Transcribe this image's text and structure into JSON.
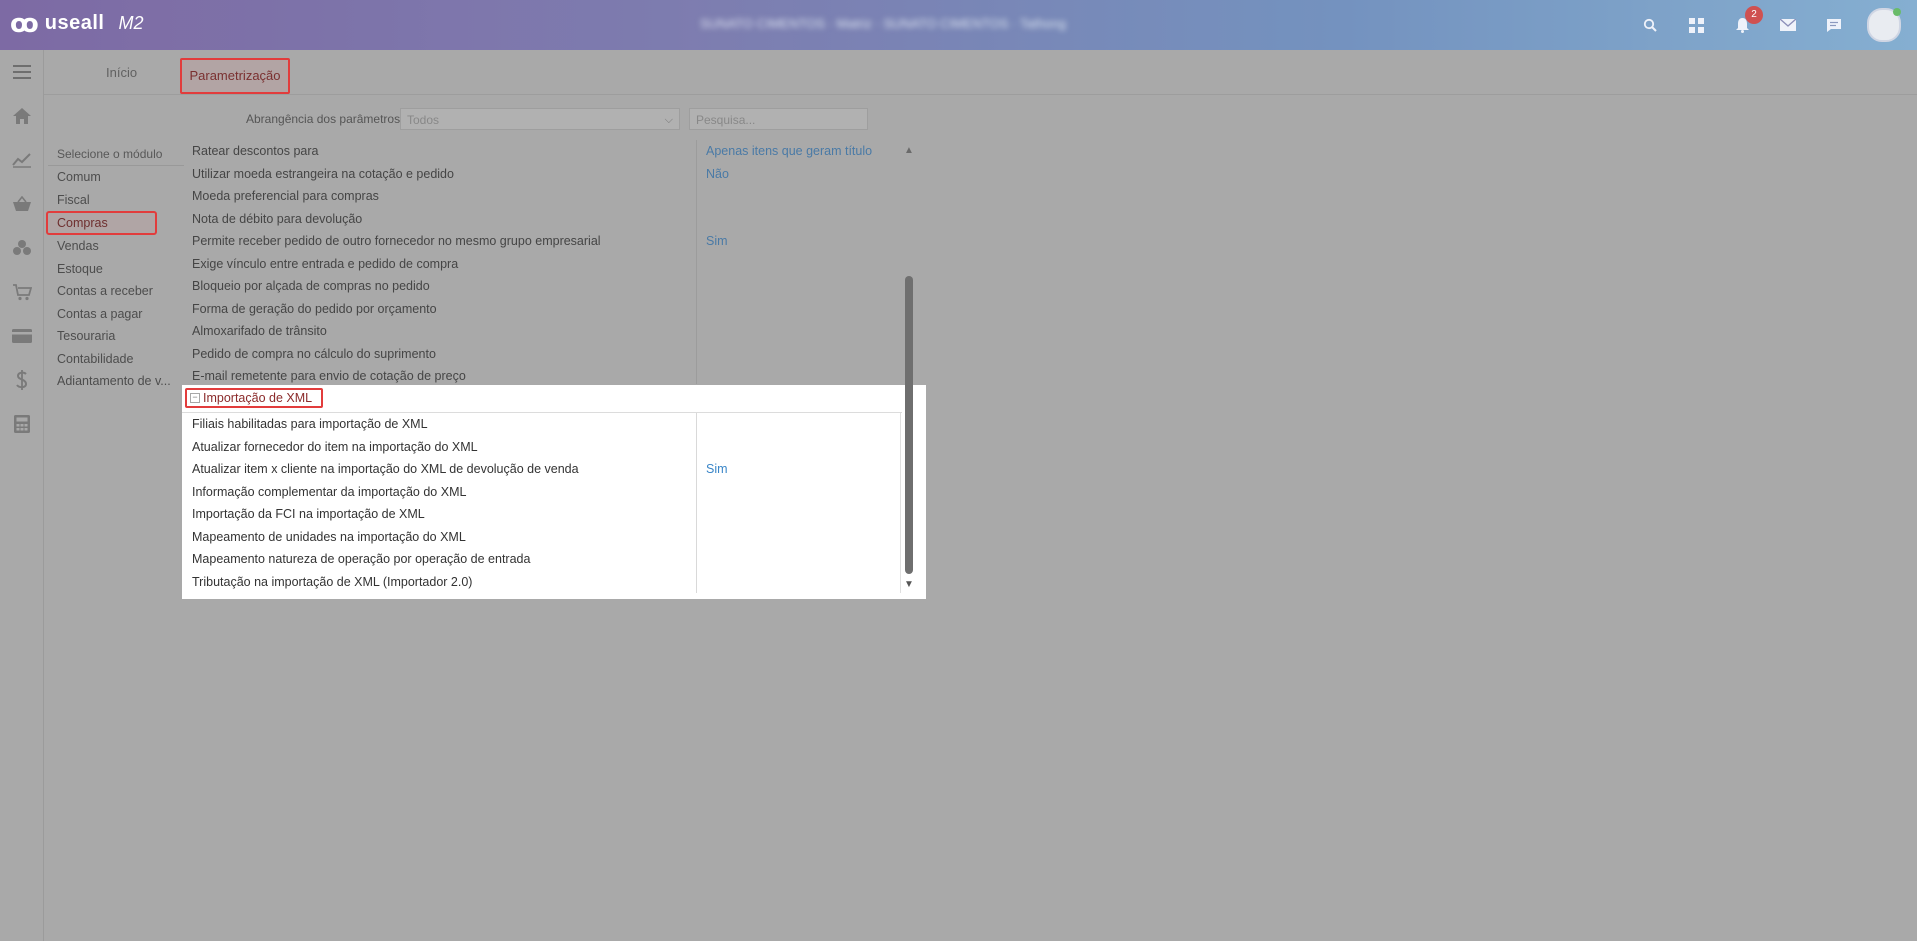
{
  "header": {
    "brand": "useall",
    "version": "M2",
    "company_info": "SUNATO CIMENTOS · Matriz · SUNATO CIMENTOS · Tathong",
    "notifications_count": "2",
    "icons": [
      "search-icon",
      "apps-icon",
      "bell-icon",
      "mail-icon",
      "chat-icon",
      "avatar"
    ]
  },
  "rail": {
    "icons": [
      "menu-icon",
      "home-icon",
      "chart-icon",
      "basket-icon",
      "boxes-icon",
      "cart-add-icon",
      "card-icon",
      "dollar-icon",
      "calculator-icon"
    ]
  },
  "tabs": [
    {
      "label": "Início"
    },
    {
      "label": "Parametrização"
    }
  ],
  "scope": {
    "label": "Abrangência dos parâmetros",
    "value": "Todos",
    "search_placeholder": "Pesquisa..."
  },
  "modules": {
    "header": "Selecione o módulo",
    "items": [
      "Comum",
      "Fiscal",
      "Compras",
      "Vendas",
      "Estoque",
      "Contas a receber",
      "Contas a pagar",
      "Tesouraria",
      "Contabilidade",
      "Adiantamento de v..."
    ]
  },
  "params": [
    {
      "name": "Ratear descontos para",
      "value": "Apenas itens que geram título"
    },
    {
      "name": "Utilizar moeda estrangeira na cotação e pedido",
      "value": "Não"
    },
    {
      "name": "Moeda preferencial para compras",
      "value": ""
    },
    {
      "name": "Nota de débito para devolução",
      "value": ""
    },
    {
      "name": "Permite receber pedido de outro fornecedor no mesmo grupo empresarial",
      "value": "Sim"
    },
    {
      "name": "Exige vínculo entre entrada e pedido de compra",
      "value": ""
    },
    {
      "name": "Bloqueio por alçada de compras no pedido",
      "value": ""
    },
    {
      "name": "Forma de geração do pedido por orçamento",
      "value": ""
    },
    {
      "name": "Almoxarifado de trânsito",
      "value": ""
    },
    {
      "name": "Pedido de compra no cálculo do suprimento",
      "value": ""
    },
    {
      "name": "E-mail remetente para envio de cotação de preço",
      "value": ""
    }
  ],
  "xml_group": {
    "title": "Importação de XML",
    "collapse_symbol": "−",
    "rows": [
      {
        "name": "Filiais habilitadas para importação de XML",
        "value": ""
      },
      {
        "name": "Atualizar fornecedor do item na importação do XML",
        "value": ""
      },
      {
        "name": "Atualizar item x cliente na importação do XML de devolução de venda",
        "value": "Sim"
      },
      {
        "name": "Informação complementar da importação do XML",
        "value": ""
      },
      {
        "name": "Importação da FCI na importação de XML",
        "value": ""
      },
      {
        "name": "Mapeamento de unidades na importação do XML",
        "value": ""
      },
      {
        "name": "Mapeamento natureza de operação por operação de entrada",
        "value": ""
      },
      {
        "name": "Tributação na importação de XML (Importador 2.0)",
        "value": ""
      }
    ]
  }
}
